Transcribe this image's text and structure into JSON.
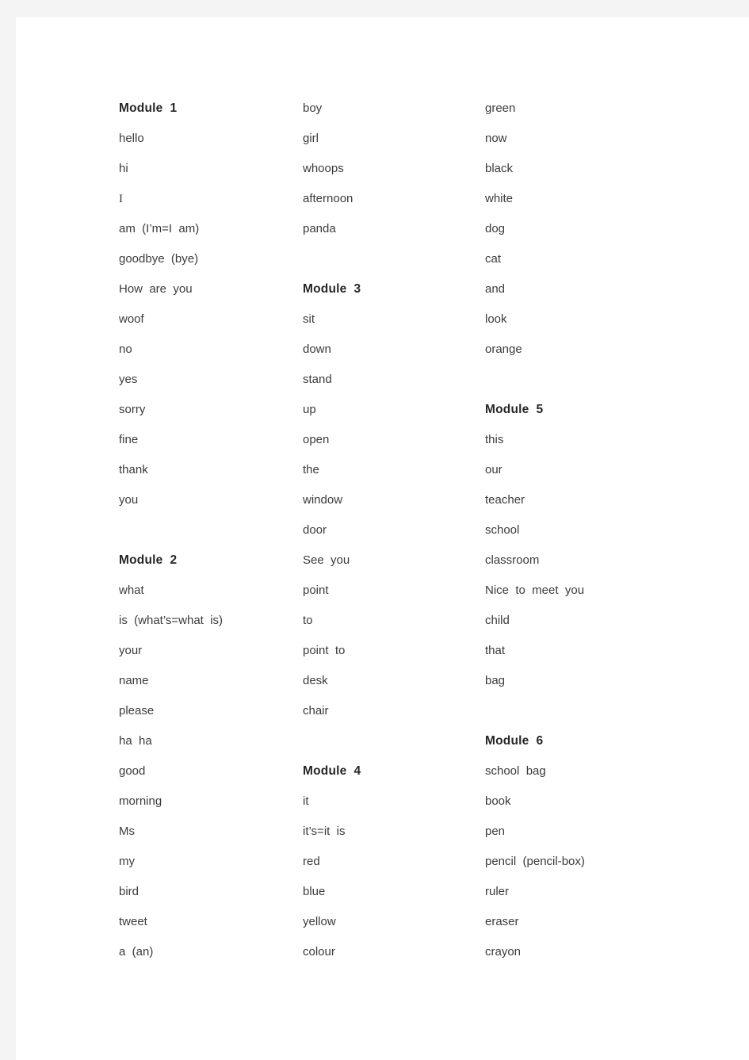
{
  "document": {
    "page_background": "#f4f4f4",
    "sheet_background": "#ffffff",
    "heading_color": "#262626",
    "text_color": "#3b3b3b"
  },
  "columns": [
    {
      "id": "column-1",
      "modules": [
        {
          "heading": "Module  1",
          "words": [
            "hello",
            "hi",
            "I",
            "am  (I’m=I  am)",
            "goodbye  (bye)",
            "How  are  you",
            "woof",
            "no",
            "yes",
            "sorry",
            "fine",
            "thank",
            "you"
          ]
        },
        {
          "heading": "Module  2",
          "words": [
            "what",
            "is  (what’s=what  is)",
            "your",
            "name",
            "please",
            "ha  ha",
            "good",
            "morning",
            "Ms",
            "my",
            "bird",
            "tweet",
            "a  (an)"
          ]
        }
      ]
    },
    {
      "id": "column-2",
      "modules": [
        {
          "heading": "",
          "words": [
            "boy",
            "girl",
            "whoops",
            "afternoon",
            "panda"
          ]
        },
        {
          "heading": "Module  3",
          "words": [
            "sit",
            "down",
            "stand",
            "up",
            "open",
            "the",
            "window",
            "door",
            "See  you",
            "point",
            "to",
            "point  to",
            "desk",
            "chair"
          ]
        },
        {
          "heading": "Module  4",
          "words": [
            "it",
            "it’s=it  is",
            "red",
            "blue",
            "yellow",
            "colour"
          ]
        }
      ]
    },
    {
      "id": "column-3",
      "modules": [
        {
          "heading": "",
          "words": [
            "green",
            "now",
            "black",
            "white",
            "dog",
            "cat",
            "and",
            "look",
            "orange"
          ]
        },
        {
          "heading": "Module  5",
          "words": [
            "this",
            "our",
            "teacher",
            "school",
            "classroom",
            "Nice  to  meet  you",
            "child",
            "that",
            "bag"
          ]
        },
        {
          "heading": "Module  6",
          "words": [
            "school  bag",
            "book",
            "pen",
            "pencil  (pencil-box)",
            "ruler",
            "eraser",
            "crayon"
          ]
        }
      ]
    }
  ]
}
